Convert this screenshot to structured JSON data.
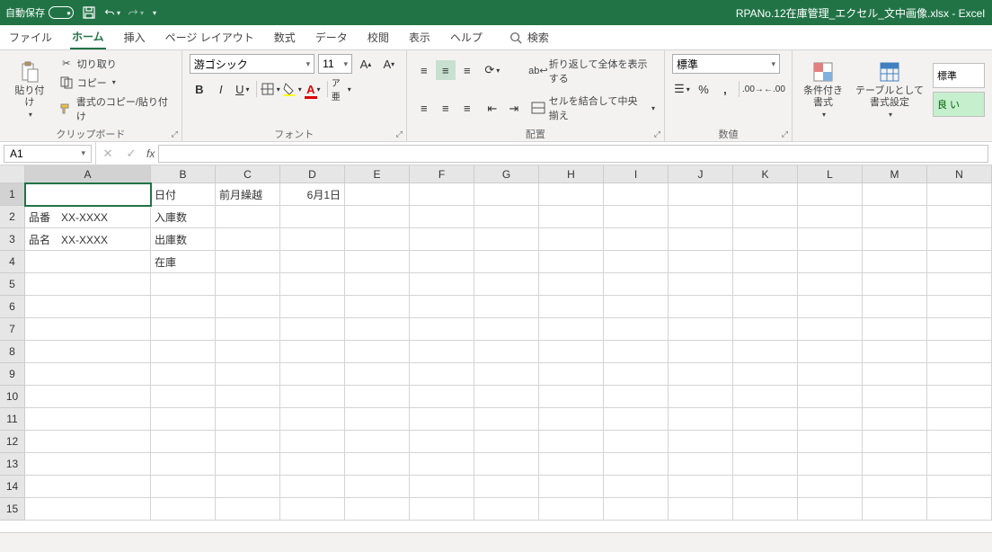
{
  "titlebar": {
    "autosave_label": "自動保存",
    "autosave_state": "オフ",
    "filename": "RPANo.12在庫管理_エクセル_文中画像.xlsx  -  Excel"
  },
  "tabs": {
    "file": "ファイル",
    "home": "ホーム",
    "insert": "挿入",
    "page_layout": "ページ レイアウト",
    "formulas": "数式",
    "data": "データ",
    "review": "校閲",
    "view": "表示",
    "help": "ヘルプ",
    "search": "検索"
  },
  "ribbon": {
    "clipboard": {
      "label": "クリップボード",
      "paste": "貼り付け",
      "cut": "切り取り",
      "copy": "コピー",
      "format_painter": "書式のコピー/貼り付け"
    },
    "font": {
      "label": "フォント",
      "name": "游ゴシック",
      "size": "11"
    },
    "alignment": {
      "label": "配置",
      "wrap": "折り返して全体を表示する",
      "merge": "セルを結合して中央揃え"
    },
    "number": {
      "label": "数値",
      "format": "標準"
    },
    "styles": {
      "cond": "条件付き\n書式",
      "table": "テーブルとして\n書式設定",
      "normal": "標準",
      "good": "良 い"
    }
  },
  "formula_bar": {
    "name": "A1",
    "value": ""
  },
  "columns": [
    "A",
    "B",
    "C",
    "D",
    "E",
    "F",
    "G",
    "H",
    "I",
    "J",
    "K",
    "L",
    "M",
    "N"
  ],
  "rows": [
    1,
    2,
    3,
    4,
    5,
    6,
    7,
    8,
    9,
    10,
    11,
    12,
    13,
    14,
    15
  ],
  "col_widths": [
    "wA",
    "wB",
    "wC",
    "wD",
    "wE",
    "wF",
    "wG",
    "wH",
    "wI",
    "wJ",
    "wK",
    "wL",
    "wM",
    "wN"
  ],
  "cells": {
    "B1": "日付",
    "C1": "前月繰越",
    "D1": "6月1日",
    "A2": "品番　XX-XXXX",
    "B2": "入庫数",
    "A3": "品名　XX-XXXX",
    "B3": "出庫数",
    "B4": "在庫"
  },
  "active_cell": "A1",
  "right_align": [
    "D1"
  ]
}
